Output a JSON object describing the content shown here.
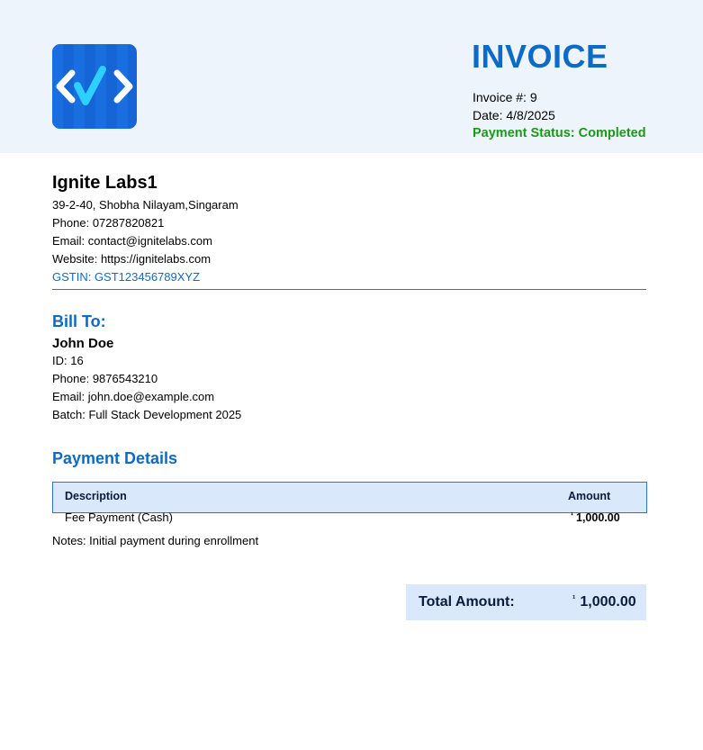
{
  "header": {
    "title": "INVOICE",
    "invoice_number": "Invoice #: 9",
    "date": "Date: 4/8/2025",
    "payment_status": "Payment Status: Completed",
    "logo_icon": "code-brackets-logo-icon"
  },
  "company": {
    "name": "Ignite Labs1",
    "address": "39-2-40, Shobha Nilayam,Singaram",
    "phone": "Phone: 07287820821",
    "email": "Email: contact@ignitelabs.com",
    "website": "Website: https://ignitelabs.com",
    "gstin": "GSTIN: GST123456789XYZ"
  },
  "bill_to": {
    "heading": "Bill To:",
    "name": "John Doe",
    "id": "ID: 16",
    "phone": "Phone: 9876543210",
    "email": "Email: john.doe@example.com",
    "batch": "Batch: Full Stack Development 2025"
  },
  "payment": {
    "heading": "Payment Details",
    "columns": [
      "Description",
      "Amount"
    ],
    "rows": [
      {
        "description": "Fee Payment (Cash)",
        "currency": "¹",
        "amount": "1,000.00"
      }
    ],
    "notes": "Notes: Initial payment during enrollment"
  },
  "total": {
    "label": "Total Amount:",
    "currency": "¹",
    "value": "1,000.00"
  },
  "colors": {
    "accent": "#0d6bc8",
    "header_bg": "#eef4fc",
    "table_bg": "#d9e8fb",
    "status_green": "#1b9a16"
  }
}
